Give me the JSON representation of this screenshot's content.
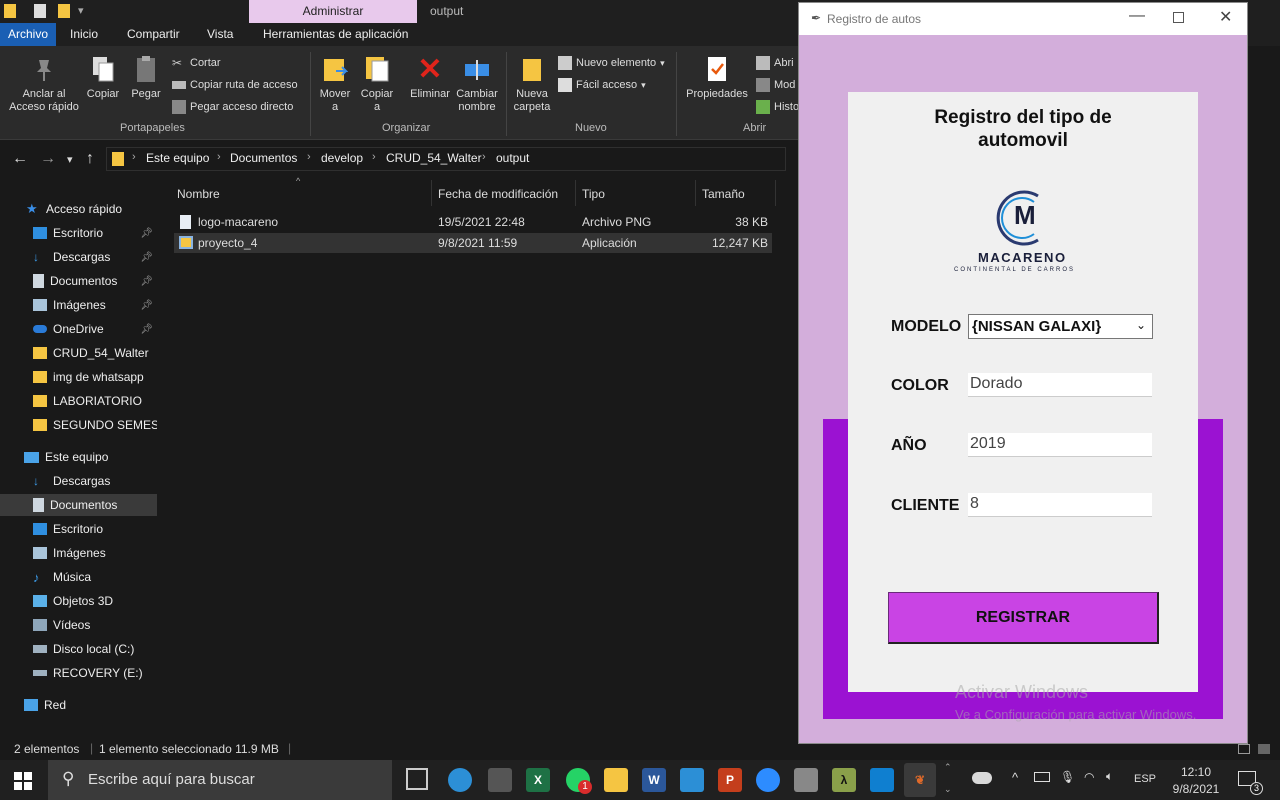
{
  "explorer": {
    "title_context_tab": "Administrar",
    "title": "output",
    "ribbon_tabs": [
      "Archivo",
      "Inicio",
      "Compartir",
      "Vista",
      "Herramientas de aplicación"
    ],
    "clipboard": {
      "pin": "Anclar al\nAcceso rápido",
      "copy": "Copiar",
      "paste": "Pegar",
      "cut": "Cortar",
      "copy_path": "Copiar ruta de acceso",
      "paste_shortcut": "Pegar acceso directo",
      "group": "Portapapeles"
    },
    "organize": {
      "move": "Mover\na",
      "copy_to": "Copiar\na",
      "delete": "Eliminar",
      "rename": "Cambiar\nnombre",
      "group": "Organizar"
    },
    "new": {
      "folder": "Nueva\ncarpeta",
      "new_item": "Nuevo elemento",
      "easy_access": "Fácil acceso",
      "group": "Nuevo"
    },
    "open": {
      "properties": "Propiedades",
      "open": "Abri",
      "modify": "Mod",
      "history": "Histo",
      "group": "Abrir"
    },
    "breadcrumb": [
      "Este equipo",
      "Documentos",
      "develop",
      "CRUD_54_Walter",
      "output"
    ],
    "sidebar": [
      {
        "label": "Acceso rápido",
        "color": "#3a8ee6"
      },
      {
        "label": "Escritorio",
        "color": "#2f8fe0",
        "pin": true
      },
      {
        "label": "Descargas",
        "color": "#3c9be8",
        "pin": true
      },
      {
        "label": "Documentos",
        "color": "#cfd8e0",
        "pin": true
      },
      {
        "label": "Imágenes",
        "color": "#a9c4da",
        "pin": true
      },
      {
        "label": "OneDrive",
        "color": "#2a7bd8",
        "pin": true
      },
      {
        "label": "CRUD_54_Walter",
        "color": "#f5c542"
      },
      {
        "label": "img de whatsapp",
        "color": "#f5c542"
      },
      {
        "label": "LABORIATORIO",
        "color": "#f5c542"
      },
      {
        "label": "SEGUNDO SEMESTR",
        "color": "#f5c542"
      },
      {
        "label": "Este equipo",
        "color": "#4aa3e8"
      },
      {
        "label": "Descargas",
        "color": "#3c9be8"
      },
      {
        "label": "Documentos",
        "color": "#cfd8e0"
      },
      {
        "label": "Escritorio",
        "color": "#2f8fe0"
      },
      {
        "label": "Imágenes",
        "color": "#a9c4da"
      },
      {
        "label": "Música",
        "color": "#3c9be8"
      },
      {
        "label": "Objetos 3D",
        "color": "#5ab0e8"
      },
      {
        "label": "Vídeos",
        "color": "#8ea6ba"
      },
      {
        "label": "Disco local (C:)",
        "color": "#9fb1c0"
      },
      {
        "label": "RECOVERY (E:)",
        "color": "#9fb1c0"
      },
      {
        "label": "Red",
        "color": "#4aa3e8"
      }
    ],
    "columns": [
      "Nombre",
      "Fecha de modificación",
      "Tipo",
      "Tamaño"
    ],
    "files": [
      {
        "name": "logo-macareno",
        "date": "19/5/2021 22:48",
        "type": "Archivo PNG",
        "size": "38 KB"
      },
      {
        "name": "proyecto_4",
        "date": "9/8/2021 11:59",
        "type": "Aplicación",
        "size": "12,247 KB"
      }
    ],
    "status_count": "2 elementos",
    "status_selected": "1 elemento seleccionado  11.9 MB"
  },
  "app": {
    "window_title": "Registro de autos",
    "heading_line1": "Registro del tipo de",
    "heading_line2": "automovil",
    "logo_letter": "M",
    "logo_name": "MACARENO",
    "logo_tagline": "CONTINENTAL DE CARROS",
    "labels": {
      "modelo": "MODELO",
      "color": "COLOR",
      "anio": "AÑO",
      "cliente": "CLIENTE"
    },
    "values": {
      "modelo": "{NISSAN GALAXI}",
      "color": "Dorado",
      "anio": "2019",
      "cliente": "8"
    },
    "button": "REGISTRAR"
  },
  "watermark": {
    "line1": "Activar Windows",
    "line2": "Ve a Configuración para activar Windows."
  },
  "taskbar": {
    "search_placeholder": "Escribe aquí para buscar",
    "lang": "ESP",
    "time": "12:10",
    "date": "9/8/2021",
    "notif_count": "3",
    "whatsapp_badge": "1"
  }
}
